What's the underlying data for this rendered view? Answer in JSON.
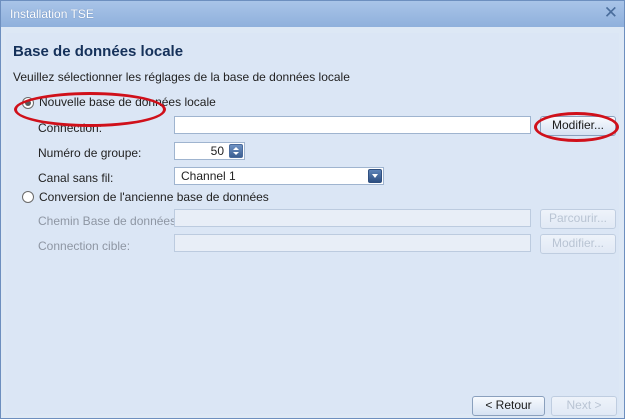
{
  "window": {
    "title": "Installation TSE",
    "close_icon": "close-icon"
  },
  "page": {
    "heading": "Base de données locale",
    "instruction": "Veuillez sélectionner les réglages de la base de données locale"
  },
  "option_new": {
    "label": "Nouvelle base de données locale",
    "selected": true,
    "connection_label": "Connection:",
    "connection_value": "",
    "modify_button": "Modifier...",
    "group_label": "Numéro de groupe:",
    "group_value": "50",
    "channel_label": "Canal sans fil:",
    "channel_value": "Channel 1"
  },
  "option_convert": {
    "label": "Conversion de l'ancienne base de données",
    "selected": false,
    "db_path_label": "Chemin Base de données:",
    "browse_button": "Parcourir...",
    "target_label": "Connection cible:",
    "modify_button": "Modifier..."
  },
  "footer": {
    "back_button": "< Retour",
    "next_button": "Next >"
  },
  "annotation_color": "#d0101a"
}
